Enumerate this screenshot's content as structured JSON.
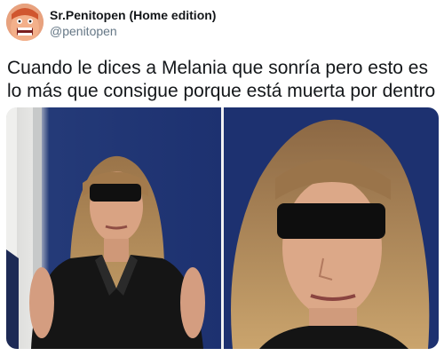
{
  "tweet": {
    "author": {
      "display_name": "Sr.Penitopen (Home edition)",
      "handle": "@penitopen",
      "avatar_icon": "cartoon-face-avatar"
    },
    "text": "Cuando le dices a Melania que sonría pero esto es lo más que consigue porque está muerta por dentro",
    "media": [
      {
        "name": "photo-wide"
      },
      {
        "name": "photo-closeup"
      }
    ]
  }
}
